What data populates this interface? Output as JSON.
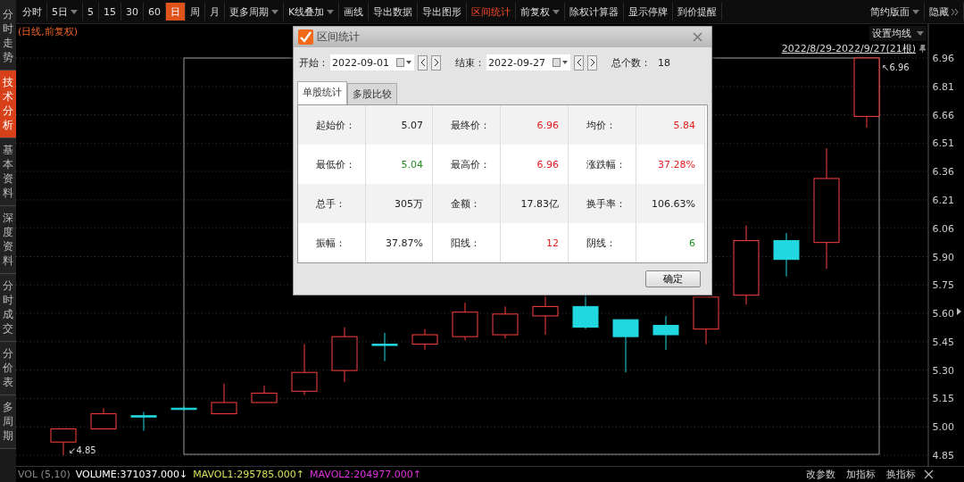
{
  "side_tabs": [
    {
      "label": "分时走势",
      "selected": false
    },
    {
      "label": "技术分析",
      "selected": true
    },
    {
      "label": "基本资料",
      "selected": false
    },
    {
      "label": "深度资料",
      "selected": false
    },
    {
      "label": "分时成交",
      "selected": false
    },
    {
      "label": "分价表",
      "selected": false
    },
    {
      "label": "多周期",
      "selected": false
    }
  ],
  "toolbar": [
    {
      "label": "分时",
      "selected": false,
      "active": false,
      "dropdown": false
    },
    {
      "label": "5日",
      "selected": false,
      "active": false,
      "dropdown": true
    },
    {
      "label": "5",
      "selected": false,
      "active": false,
      "dropdown": false
    },
    {
      "label": "15",
      "selected": false,
      "active": false,
      "dropdown": false
    },
    {
      "label": "30",
      "selected": false,
      "active": false,
      "dropdown": false
    },
    {
      "label": "60",
      "selected": false,
      "active": false,
      "dropdown": false
    },
    {
      "label": "日",
      "selected": true,
      "active": false,
      "dropdown": false
    },
    {
      "label": "周",
      "selected": false,
      "active": false,
      "dropdown": false
    },
    {
      "label": "月",
      "selected": false,
      "active": false,
      "dropdown": false
    },
    {
      "label": "更多周期",
      "selected": false,
      "active": false,
      "dropdown": true
    },
    {
      "label": "K线叠加",
      "selected": false,
      "active": false,
      "dropdown": true
    },
    {
      "label": "画线",
      "selected": false,
      "active": false,
      "dropdown": false
    },
    {
      "label": "导出数据",
      "selected": false,
      "active": false,
      "dropdown": false
    },
    {
      "label": "导出图形",
      "selected": false,
      "active": false,
      "dropdown": false
    },
    {
      "label": "区间统计",
      "selected": false,
      "active": true,
      "dropdown": false
    },
    {
      "label": "前复权",
      "selected": false,
      "active": false,
      "dropdown": true
    },
    {
      "label": "除权计算器",
      "selected": false,
      "active": false,
      "dropdown": false
    },
    {
      "label": "显示停牌",
      "selected": false,
      "active": false,
      "dropdown": false
    },
    {
      "label": "到价提醒",
      "selected": false,
      "active": false,
      "dropdown": false
    }
  ],
  "toolbar_right": [
    {
      "label": "简约版面",
      "dropdown": true
    },
    {
      "label": "隐藏",
      "dropdown": false
    }
  ],
  "chart_header": {
    "mode": "(日线,前复权)",
    "ma_button": "设置均线",
    "range": "2022/8/29-2022/9/27(21根)"
  },
  "price_axis": {
    "ticks": [
      "6.96",
      "6.81",
      "6.66",
      "6.51",
      "6.36",
      "6.21",
      "6.06",
      "5.90",
      "5.75",
      "5.60",
      "5.45",
      "5.30",
      "5.15",
      "5.00",
      "4.85"
    ]
  },
  "markers": [
    {
      "text": "↙4.85"
    },
    {
      "text": "↖6.96"
    }
  ],
  "status_bar": {
    "indicator": "VOL (5,10)",
    "values": [
      {
        "text": "VOLUME:371037.000↓",
        "color": "#ffffff"
      },
      {
        "text": "MAVOL1:295785.000↑",
        "color": "#d4e05a"
      },
      {
        "text": "MAVOL2:204977.000↑",
        "color": "#e030e0"
      }
    ],
    "actions": [
      "改参数",
      "加指标",
      "换指标"
    ]
  },
  "dialog": {
    "title": "区间统计",
    "start_label": "开始：",
    "start": "2022-09-01",
    "end_label": "结束：",
    "end": "2022-09-27",
    "count_label": "总个数：",
    "count": "18",
    "tabs": [
      {
        "label": "单股统计",
        "selected": true
      },
      {
        "label": "多股比较",
        "selected": false
      }
    ],
    "rows": [
      [
        {
          "label": "起始价：",
          "value": "5.07",
          "color": "#222222"
        },
        {
          "label": "最终价：",
          "value": "6.96",
          "color": "#e02020"
        },
        {
          "label": "均价：",
          "value": "5.84",
          "color": "#e02020"
        }
      ],
      [
        {
          "label": "最低价：",
          "value": "5.04",
          "color": "#209020"
        },
        {
          "label": "最高价：",
          "value": "6.96",
          "color": "#e02020"
        },
        {
          "label": "涨跌幅：",
          "value": "37.28%",
          "color": "#e02020"
        }
      ],
      [
        {
          "label": "总手：",
          "value": "305万",
          "color": "#222222"
        },
        {
          "label": "金额：",
          "value": "17.83亿",
          "color": "#222222"
        },
        {
          "label": "换手率：",
          "value": "106.63%",
          "color": "#222222"
        }
      ],
      [
        {
          "label": "振幅：",
          "value": "37.87%",
          "color": "#222222"
        },
        {
          "label": "阳线：",
          "value": "12",
          "color": "#e02020"
        },
        {
          "label": "阴线：",
          "value": "6",
          "color": "#209020"
        }
      ]
    ],
    "ok": "确定"
  }
}
